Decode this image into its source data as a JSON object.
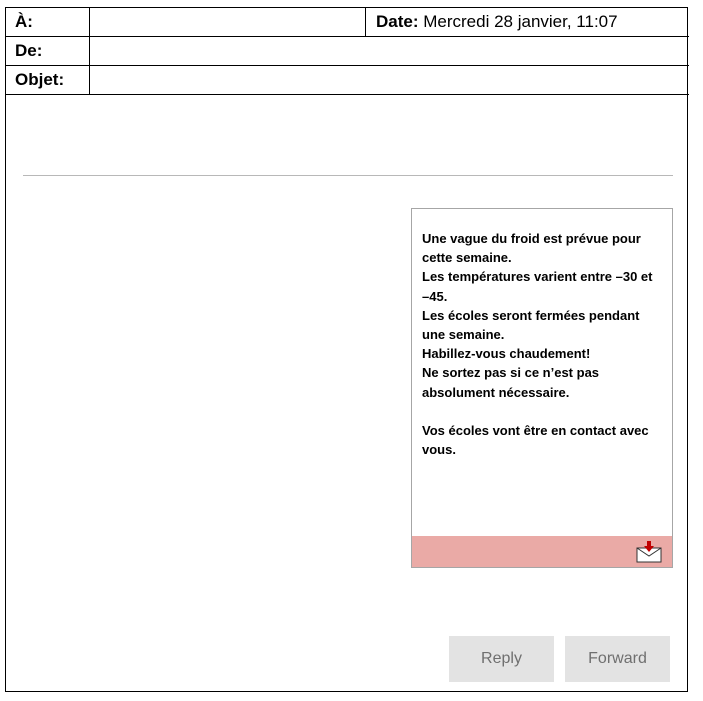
{
  "header": {
    "to_label": "À:",
    "to_value": "",
    "date_label": "Date:",
    "date_value": " Mercredi 28 janvier, 11:07",
    "from_label": "De:",
    "from_value": "",
    "subject_label": "Objet:",
    "subject_value": ""
  },
  "message": {
    "lines": [
      "Une vague du froid est prévue pour cette semaine.",
      "Les températures varient entre –30 et –45.",
      "Les écoles seront fermées pendant une semaine.",
      "Habillez-vous chaudement!",
      "Ne sortez pas si ce n’est pas absolument nécessaire.",
      "Vos écoles vont être en contact avec vous."
    ],
    "footer_color": "#eaaaa6",
    "footer_icon": "mail-download-icon"
  },
  "actions": {
    "reply_label": "Reply",
    "forward_label": "Forward"
  }
}
